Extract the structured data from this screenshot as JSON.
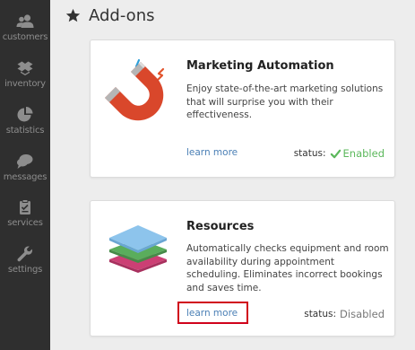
{
  "sidebar": {
    "items": [
      {
        "label": "customers",
        "icon": "customers-icon"
      },
      {
        "label": "inventory",
        "icon": "inventory-icon"
      },
      {
        "label": "statistics",
        "icon": "statistics-icon"
      },
      {
        "label": "messages",
        "icon": "messages-icon"
      },
      {
        "label": "services",
        "icon": "services-icon"
      },
      {
        "label": "settings",
        "icon": "settings-icon"
      }
    ]
  },
  "header": {
    "title": "Add-ons",
    "icon": "star-icon"
  },
  "addons": [
    {
      "title": "Marketing Automation",
      "description": "Enjoy state-of-the-art marketing solutions that will surprise you with their effectiveness.",
      "link": "learn more",
      "status_label": "status:",
      "status_value": "Enabled",
      "icon": "magnet-icon"
    },
    {
      "title": "Resources",
      "description": "Automatically checks equipment and room availability during appointment scheduling. Eliminates incorrect bookings and saves time.",
      "link": "learn more",
      "status_label": "status:",
      "status_value": "Disabled",
      "icon": "layers-icon"
    }
  ],
  "colors": {
    "sidebar_bg": "#2f2f2f",
    "link": "#4a7fb5",
    "enabled": "#5cb85c",
    "highlight": "#d0021b"
  }
}
